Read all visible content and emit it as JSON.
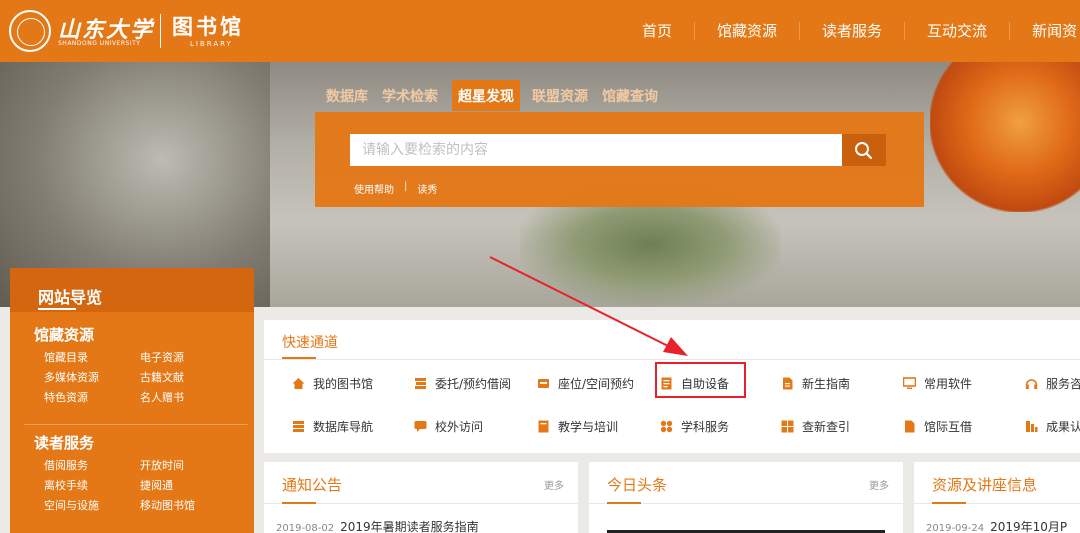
{
  "header": {
    "logo_cn": "山东大学",
    "logo_en": "SHANDONG UNIVERSITY",
    "library_cn": "图书馆",
    "library_en": "LIBRARY",
    "nav": [
      "首页",
      "馆藏资源",
      "读者服务",
      "互动交流",
      "新闻资"
    ]
  },
  "search": {
    "tabs": [
      "数据库",
      "学术检索",
      "超星发现",
      "联盟资源",
      "馆藏查询"
    ],
    "active_tab": "超星发现",
    "placeholder": "请输入要检索的内容",
    "button_icon": "search-icon",
    "links": [
      "使用帮助",
      "读秀"
    ]
  },
  "sidebar": {
    "title": "网站导览",
    "sections": [
      {
        "title": "馆藏资源",
        "items": [
          "馆藏目录",
          "电子资源",
          "多媒体资源",
          "古籍文献",
          "特色资源",
          "名人赠书"
        ]
      },
      {
        "title": "读者服务",
        "items": [
          "借阅服务",
          "开放时间",
          "离校手续",
          "捷阅通",
          "空间与设施",
          "移动图书馆"
        ]
      }
    ]
  },
  "quick": {
    "title": "快速通道",
    "items": [
      {
        "label": "我的图书馆",
        "icon": "home-icon"
      },
      {
        "label": "委托/预约借阅",
        "icon": "books-icon"
      },
      {
        "label": "座位/空间预约",
        "icon": "seat-icon"
      },
      {
        "label": "自助设备",
        "icon": "document-icon"
      },
      {
        "label": "新生指南",
        "icon": "file-icon"
      },
      {
        "label": "常用软件",
        "icon": "monitor-icon"
      },
      {
        "label": "服务咨",
        "icon": "headphones-icon"
      },
      {
        "label": "数据库导航",
        "icon": "database-icon"
      },
      {
        "label": "校外访问",
        "icon": "chat-icon"
      },
      {
        "label": "教学与培训",
        "icon": "notebook-icon"
      },
      {
        "label": "学科服务",
        "icon": "puzzle-icon"
      },
      {
        "label": "查新查引",
        "icon": "grid-icon"
      },
      {
        "label": "馆际互借",
        "icon": "file-icon"
      },
      {
        "label": "成果认",
        "icon": "chart-icon"
      }
    ],
    "highlighted": "自助设备"
  },
  "news": [
    {
      "title": "通知公告",
      "more": "更多",
      "date": "2019-08-02",
      "headline": "2019年暑期读者服务指南"
    },
    {
      "title": "今日头条",
      "more": "更多"
    },
    {
      "title": "资源及讲座信息",
      "date": "2019-09-24",
      "headline": "2019年10月P"
    }
  ],
  "colors": {
    "brand": "#e47817",
    "highlight": "#e8222b"
  }
}
